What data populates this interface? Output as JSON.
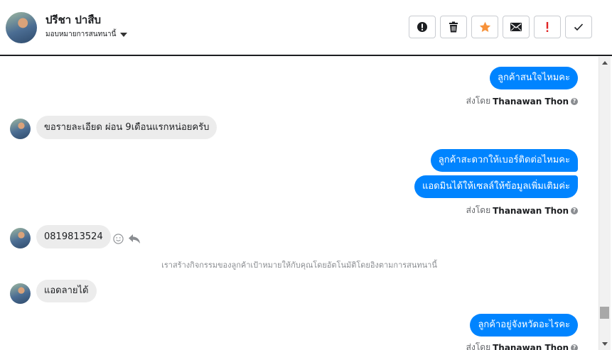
{
  "header": {
    "contact_name": "ปรีชา ปาสืบ",
    "assign_label": "มอบหมายการสนทนานี้",
    "toolbar": [
      {
        "name": "alert-circle-icon"
      },
      {
        "name": "trash-icon"
      },
      {
        "name": "star-icon",
        "color": "#f7923a"
      },
      {
        "name": "envelope-icon"
      },
      {
        "name": "exclamation-icon",
        "color": "#e02424"
      },
      {
        "name": "check-icon"
      }
    ]
  },
  "messages": {
    "m1": "ลูกค้าสนใจไหมคะ",
    "sent1_prefix": "ส่งโดย",
    "sent1_agent": "Thanawan Thon",
    "m2": "ขอรายละเอียด ผ่อน 9เดือนแรกหน่อยครับ",
    "m3": "ลูกค้าสะดวกให้เบอร์ติดต่อไหมคะ",
    "m4": "แอดมินได้ให้เซลล์ให้ข้อมูลเพิ่มเติมค่ะ",
    "sent2_prefix": "ส่งโดย",
    "sent2_agent": "Thanawan Thon",
    "m5": "0819813524",
    "system_note": "เราสร้างกิจกรรมของลูกค้าเป้าหมายให้กับคุณโดยอัตโนมัติโดยอิงตามการสนทนานี้",
    "m6": "แอดลายได้",
    "m7": "ลูกค้าอยู่จังหวัดอะไรคะ",
    "sent3_prefix": "ส่งโดย",
    "sent3_agent": "Thanawan Thon",
    "help_mark": "?"
  },
  "colors": {
    "outgoing_bubble": "#0084ff",
    "incoming_bubble": "#ececec"
  }
}
